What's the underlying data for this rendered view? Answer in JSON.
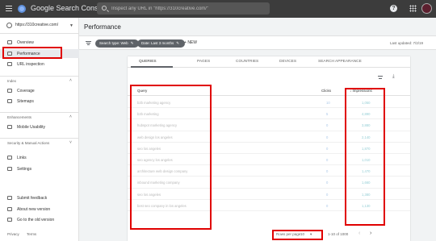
{
  "topbar": {
    "brand": "Google Search Console",
    "search_placeholder": "Inspect any URL in \"https://310creative.com/\"",
    "help": "?"
  },
  "sidebar": {
    "property": "https://310creative.com/",
    "nav": [
      {
        "label": "Overview",
        "icon": "home-icon"
      },
      {
        "label": "Performance",
        "icon": "trending-up-icon"
      },
      {
        "label": "URL inspection",
        "icon": "search-icon"
      }
    ],
    "index_title": "Index",
    "index_items": [
      {
        "label": "Coverage",
        "icon": "coverage-icon"
      },
      {
        "label": "Sitemaps",
        "icon": "sitemap-icon"
      }
    ],
    "enhancements_title": "Enhancements",
    "enhancements_items": [
      {
        "label": "Mobile Usability",
        "icon": "mobile-icon"
      }
    ],
    "security_title": "Security & Manual Actions",
    "other_items": [
      {
        "label": "Links",
        "icon": "links-icon"
      },
      {
        "label": "Settings",
        "icon": "settings-icon"
      }
    ],
    "bottom_items": [
      {
        "label": "Submit feedback",
        "icon": "feedback-icon"
      },
      {
        "label": "About new version",
        "icon": "info-icon"
      },
      {
        "label": "Go to the old version",
        "icon": "exit-icon"
      }
    ],
    "footer": {
      "privacy": "Privacy",
      "terms": "Terms"
    }
  },
  "main": {
    "title": "Performance",
    "filters": {
      "search_type": "Search type: Web",
      "date": "Date: Last 3 months",
      "new_label": "NEW",
      "last_updated": "Last updated: 7/2/19"
    },
    "tabs": [
      "QUERIES",
      "PAGES",
      "COUNTRIES",
      "DEVICES",
      "SEARCH APPEARANCE"
    ],
    "table": {
      "headers": {
        "query": "Query",
        "clicks": "Clicks",
        "impressions": "Impressions"
      },
      "rows": [
        {
          "query": "b2b marketing agency",
          "clicks": "10",
          "impressions": "1,050"
        },
        {
          "query": "b2b marketing",
          "clicks": "5",
          "impressions": "4,890"
        },
        {
          "query": "hubspot marketing agency",
          "clicks": "0",
          "impressions": "3,880"
        },
        {
          "query": "web design los angeles",
          "clicks": "0",
          "impressions": "2,140"
        },
        {
          "query": "seo los angeles",
          "clicks": "0",
          "impressions": "1,870"
        },
        {
          "query": "seo agency los angeles",
          "clicks": "0",
          "impressions": "1,010"
        },
        {
          "query": "architecture web design company",
          "clicks": "0",
          "impressions": "1,470"
        },
        {
          "query": "inbound marketing company",
          "clicks": "0",
          "impressions": "1,660"
        },
        {
          "query": "seo los angeles",
          "clicks": "0",
          "impressions": "1,380"
        },
        {
          "query": "best seo company in los angeles",
          "clicks": "0",
          "impressions": "1,130"
        }
      ]
    },
    "pager": {
      "rows_per_page_label": "Rows per page:",
      "rows_per_page_value": "10",
      "range": "1-10 of 1000"
    }
  },
  "colors": {
    "topbar": "#3c3c3c",
    "highlight": "#e00000",
    "active_nav": "#e8eaed"
  }
}
